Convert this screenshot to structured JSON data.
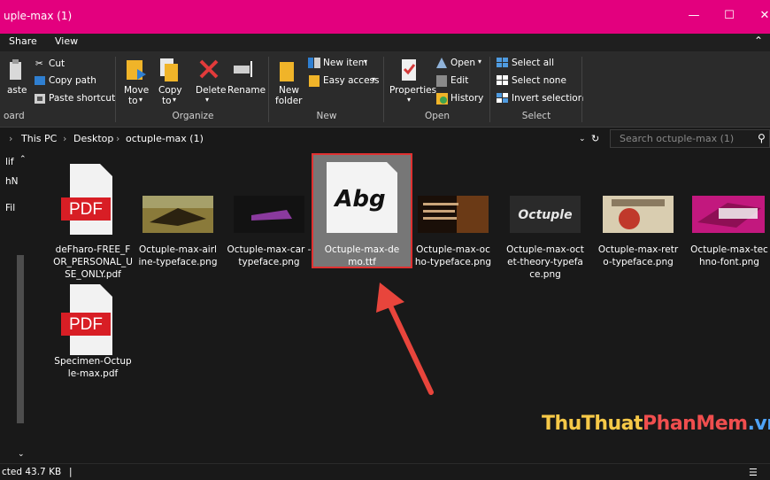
{
  "window": {
    "title": "uple-max (1)"
  },
  "tabs": {
    "share": "Share",
    "view": "View"
  },
  "ribbon": {
    "clipboard": {
      "paste": "aste",
      "cut": "Cut",
      "copy_path": "Copy path",
      "paste_shortcut": "Paste shortcut",
      "group": "oard"
    },
    "organize": {
      "move_to": "Move",
      "move_to2": "to",
      "copy_to": "Copy",
      "copy_to2": "to",
      "delete": "Delete",
      "rename": "Rename",
      "group": "Organize"
    },
    "new": {
      "new_folder": "New",
      "new_folder2": "folder",
      "new_item": "New item",
      "easy_access": "Easy access",
      "group": "New"
    },
    "open": {
      "properties": "Properties",
      "open": "Open",
      "edit": "Edit",
      "history": "History",
      "group": "Open"
    },
    "select": {
      "select_all": "Select all",
      "select_none": "Select none",
      "invert": "Invert selection",
      "group": "Select"
    }
  },
  "address": {
    "this_pc": "This PC",
    "desktop": "Desktop",
    "folder": "octuple-max (1)",
    "search_placeholder": "Search octuple-max (1)"
  },
  "nav": {
    "item1": "lif",
    "item2": "hN",
    "item3": "Fil"
  },
  "files": [
    {
      "name": "deFharo-FREE_FOR_PERSONAL_USE_ONLY.pdf",
      "label": "deFharo-FREE_F OR_PERSONAL_U SE_ONLY.pdf",
      "type": "pdf"
    },
    {
      "name": "Octuple-max-airline-typeface.png",
      "label": "Octuple-max-airl ine-typeface.png",
      "type": "png"
    },
    {
      "name": "Octuple-max-car-typeface.png",
      "label": "Octuple-max-car -typeface.png",
      "type": "png"
    },
    {
      "name": "Octuple-max-demo.ttf",
      "label": "Octuple-max-de mo.ttf",
      "type": "ttf",
      "preview_text": "Abg"
    },
    {
      "name": "Octuple-max-ocho-typeface.png",
      "label": "Octuple-max-oc ho-typeface.png",
      "type": "png"
    },
    {
      "name": "Octuple-max-octet-theory-typeface.png",
      "label": "Octuple-max-oct et-theory-typefa ce.png",
      "type": "png",
      "preview_text": "Octuple"
    },
    {
      "name": "Octuple-max-retro-typeface.png",
      "label": "Octuple-max-retr o-typeface.png",
      "type": "png"
    },
    {
      "name": "Octuple-max-techno-font.png",
      "label": "Octuple-max-tec hno-font.png",
      "type": "png"
    },
    {
      "name": "Specimen-Octuple-max.pdf",
      "label": "Specimen-Octup le-max.pdf",
      "type": "pdf"
    }
  ],
  "pdf_badge": "PDF",
  "status": {
    "selected": "cted  43.7 KB"
  },
  "watermark": {
    "part1": "ThuThuat",
    "part2": "PhanMem",
    "part3": ".vn"
  },
  "colors": {
    "titlebar": "#e3007e",
    "selection_outline": "#e03131",
    "arrow": "#e8453c"
  }
}
